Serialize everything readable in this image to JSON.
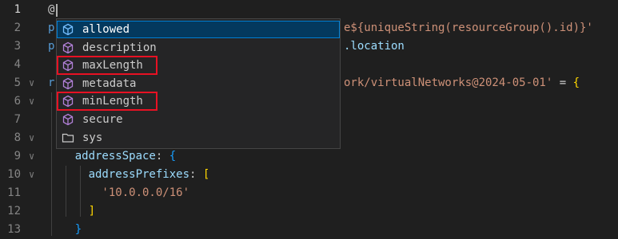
{
  "editor": {
    "lines": [
      {
        "num": "1",
        "active": true,
        "fold": false,
        "segments": [
          {
            "t": "@",
            "c": "tok-plain"
          }
        ]
      },
      {
        "num": "2",
        "fold": false,
        "segments": [
          {
            "t": "p",
            "c": "tok-kw"
          }
        ],
        "tail": [
          {
            "t": "e${uniqueString(resourceGroup().id)}'",
            "c": "tok-str"
          }
        ]
      },
      {
        "num": "3",
        "fold": false,
        "segments": [
          {
            "t": "p",
            "c": "tok-kw"
          }
        ],
        "tail": [
          {
            "t": ".location",
            "c": "tok-prop"
          }
        ]
      },
      {
        "num": "4",
        "fold": false,
        "segments": [],
        "tail": []
      },
      {
        "num": "5",
        "fold": true,
        "segments": [
          {
            "t": "r",
            "c": "tok-kw"
          }
        ],
        "tail": [
          {
            "t": "ork/virtualNetworks@2024-05-01'",
            "c": "tok-str"
          },
          {
            "t": " = ",
            "c": "tok-plain"
          },
          {
            "t": "{",
            "c": "tok-br1"
          }
        ]
      },
      {
        "num": "6",
        "fold": true,
        "segments": [],
        "tail": []
      },
      {
        "num": "7",
        "fold": false,
        "segments": [],
        "tail": []
      },
      {
        "num": "8",
        "fold": true,
        "segments": [],
        "tail": []
      },
      {
        "num": "9",
        "fold": true,
        "segments": [
          {
            "t": "    addressSpace",
            "c": "tok-prop"
          },
          {
            "t": ": ",
            "c": "tok-plain"
          },
          {
            "t": "{",
            "c": "tok-br3"
          }
        ]
      },
      {
        "num": "10",
        "fold": true,
        "segments": [
          {
            "t": "      addressPrefixes",
            "c": "tok-prop"
          },
          {
            "t": ": ",
            "c": "tok-plain"
          },
          {
            "t": "[",
            "c": "tok-br1"
          }
        ]
      },
      {
        "num": "11",
        "fold": false,
        "segments": [
          {
            "t": "        '10.0.0.0/16'",
            "c": "tok-str"
          }
        ]
      },
      {
        "num": "12",
        "fold": false,
        "segments": [
          {
            "t": "      ]",
            "c": "tok-br1"
          }
        ]
      },
      {
        "num": "13",
        "fold": false,
        "segments": [
          {
            "t": "    }",
            "c": "tok-br3"
          }
        ]
      }
    ]
  },
  "suggest": {
    "items": [
      {
        "label": "allowed",
        "icon": "property-icon",
        "selected": true,
        "highlighted": false
      },
      {
        "label": "description",
        "icon": "property-icon",
        "selected": false,
        "highlighted": false
      },
      {
        "label": "maxLength",
        "icon": "property-icon",
        "selected": false,
        "highlighted": true
      },
      {
        "label": "metadata",
        "icon": "property-icon",
        "selected": false,
        "highlighted": false
      },
      {
        "label": "minLength",
        "icon": "property-icon",
        "selected": false,
        "highlighted": true
      },
      {
        "label": "secure",
        "icon": "property-icon",
        "selected": false,
        "highlighted": false
      },
      {
        "label": "sys",
        "icon": "folder-icon",
        "selected": false,
        "highlighted": false
      }
    ]
  },
  "colors": {
    "background": "#1f1f1f",
    "widget": "#252526",
    "selection": "#04395e",
    "highlight_box": "#e81123",
    "property_icon": "#b180d7"
  }
}
